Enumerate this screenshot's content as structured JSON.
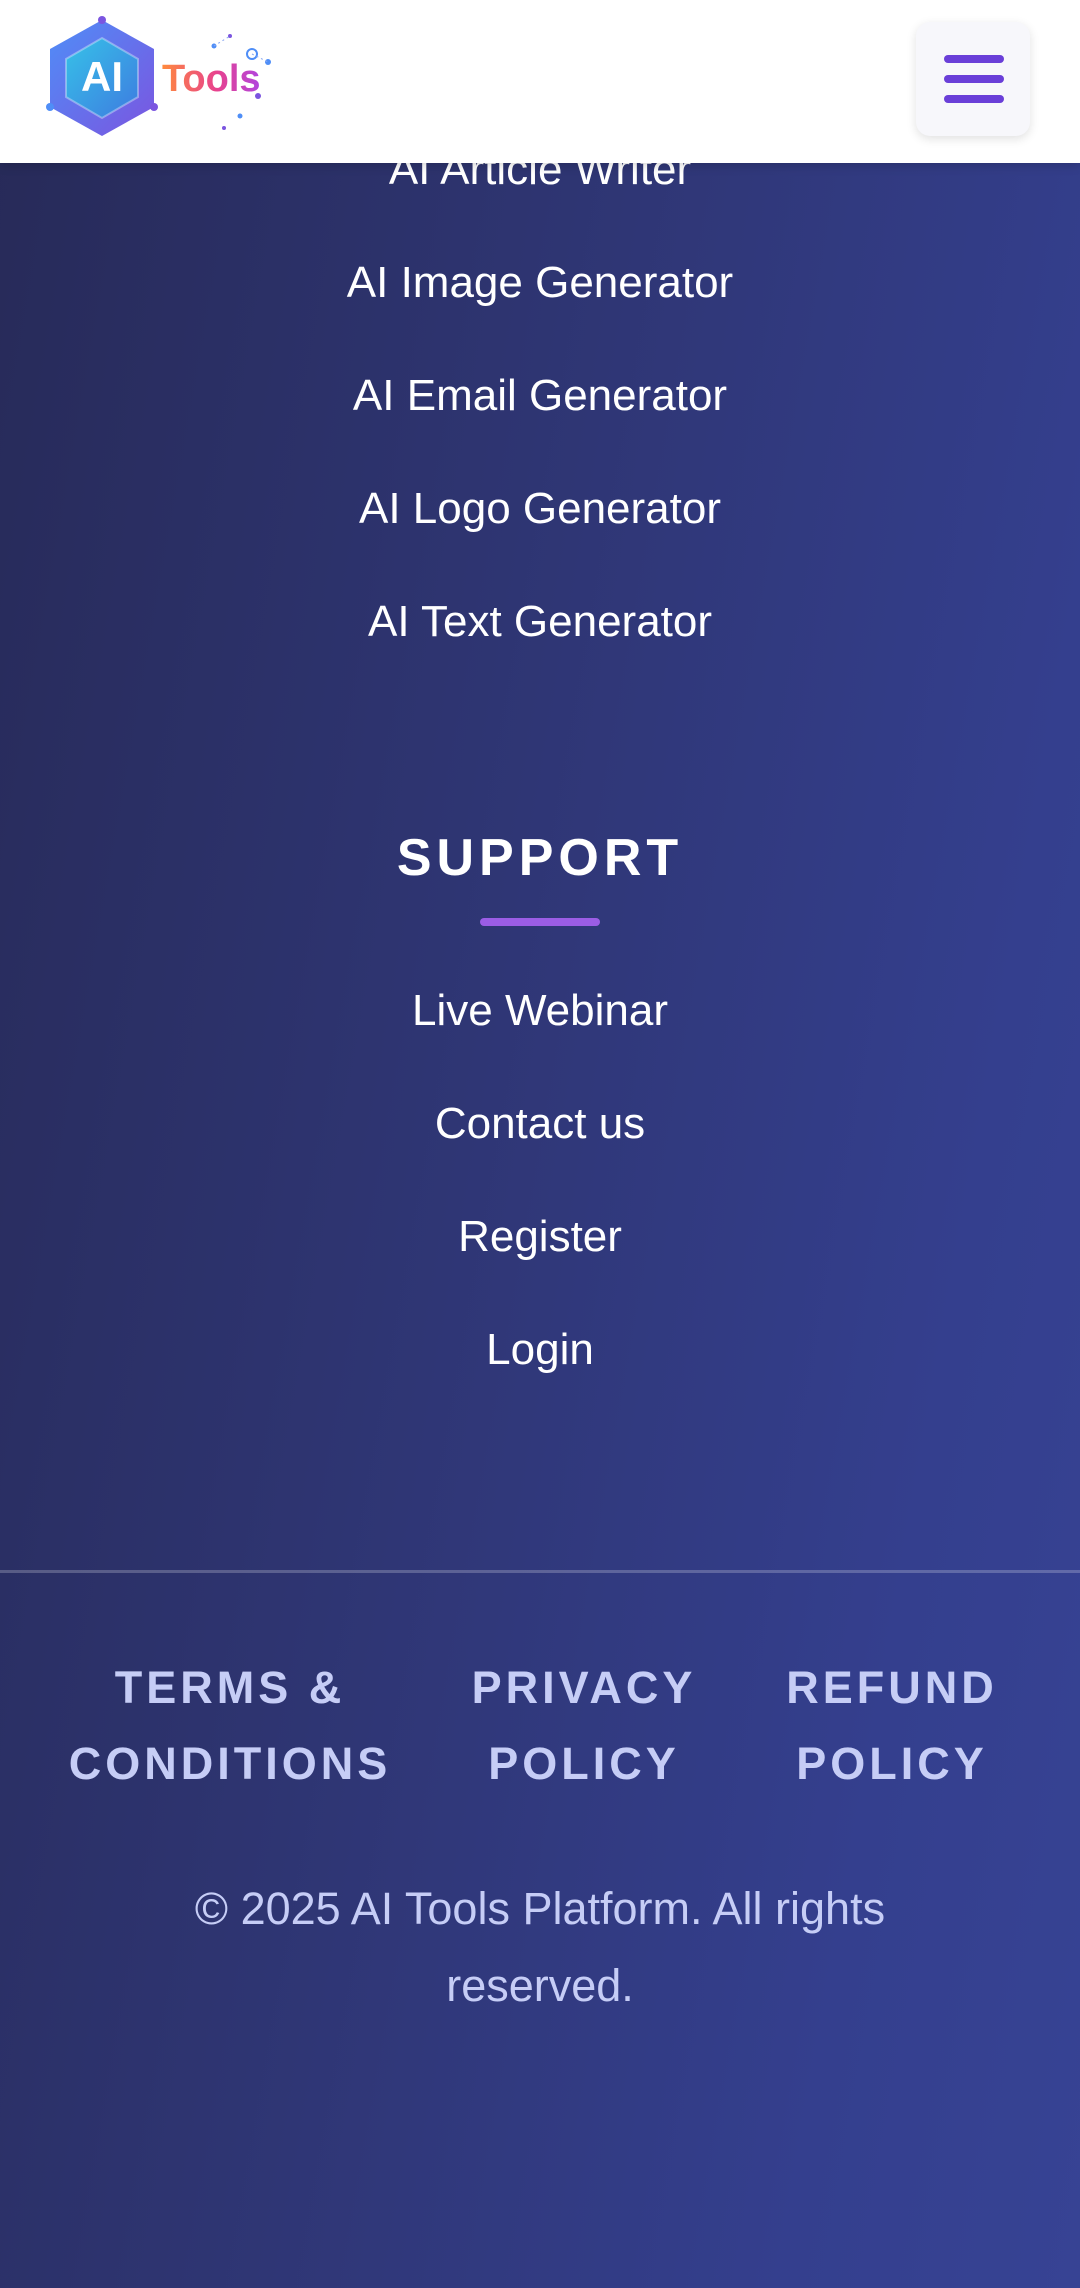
{
  "header": {
    "logo_ai": "AI",
    "logo_tools": "Tools",
    "menu_icon": "hamburger-menu-icon"
  },
  "tools": {
    "links": [
      "AI Article Writer",
      "AI Image Generator",
      "AI Email Generator",
      "AI Logo Generator",
      "AI Text Generator"
    ]
  },
  "support": {
    "title": "SUPPORT",
    "links": [
      "Live Webinar",
      "Contact us",
      "Register",
      "Login"
    ]
  },
  "legal": {
    "terms": "TERMS & CONDITIONS",
    "privacy": "PRIVACY POLICY",
    "refund": "REFUND POLICY"
  },
  "copyright": "© 2025 AI Tools Platform. All rights reserved.",
  "colors": {
    "accent": "#6a3fd8",
    "underline": "#9b5de5",
    "background_start": "#272a58",
    "background_end": "#374394",
    "legal_text": "#c6cdf6"
  }
}
